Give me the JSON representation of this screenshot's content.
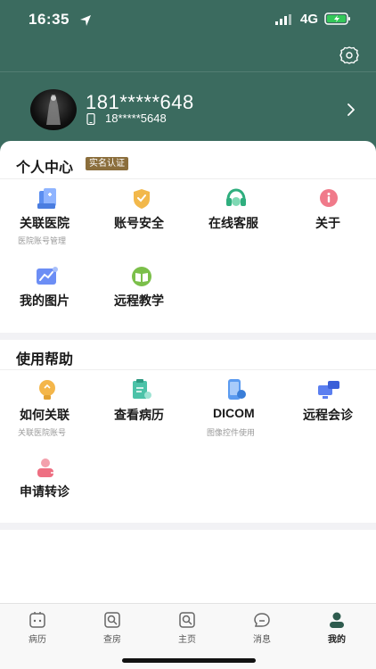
{
  "status": {
    "time": "16:35",
    "network": "4G"
  },
  "profile": {
    "name": "181*****648",
    "phone": "18*****5648"
  },
  "personal": {
    "title": "个人中心",
    "badge": "实名认证",
    "items": [
      {
        "label": "关联医院",
        "sub": "医院账号管理",
        "icon": "hospital-icon"
      },
      {
        "label": "账号安全",
        "sub": "",
        "icon": "shield-icon"
      },
      {
        "label": "在线客服",
        "sub": "",
        "icon": "headset-icon"
      },
      {
        "label": "关于",
        "sub": "",
        "icon": "info-icon"
      },
      {
        "label": "我的图片",
        "sub": "",
        "icon": "chart-image-icon"
      },
      {
        "label": "远程教学",
        "sub": "",
        "icon": "book-icon"
      }
    ]
  },
  "help": {
    "title": "使用帮助",
    "items": [
      {
        "label": "如何关联",
        "sub": "关联医院账号",
        "icon": "bulb-icon"
      },
      {
        "label": "查看病历",
        "sub": "",
        "icon": "medical-record-icon"
      },
      {
        "label": "DICOM",
        "sub": "图像控件使用",
        "icon": "dicom-device-icon"
      },
      {
        "label": "远程会诊",
        "sub": "",
        "icon": "video-consult-icon"
      },
      {
        "label": "申请转诊",
        "sub": "",
        "icon": "referral-icon"
      }
    ]
  },
  "tabs": [
    {
      "label": "病历",
      "icon": "record-tab-icon"
    },
    {
      "label": "查房",
      "icon": "ward-round-tab-icon"
    },
    {
      "label": "主页",
      "icon": "home-tab-icon"
    },
    {
      "label": "消息",
      "icon": "message-tab-icon"
    },
    {
      "label": "我的",
      "icon": "profile-tab-icon",
      "active": true
    }
  ],
  "colors": {
    "header": "#3b6b5f",
    "badge": "#8b6e3c",
    "accent": "#2e5b4e"
  }
}
